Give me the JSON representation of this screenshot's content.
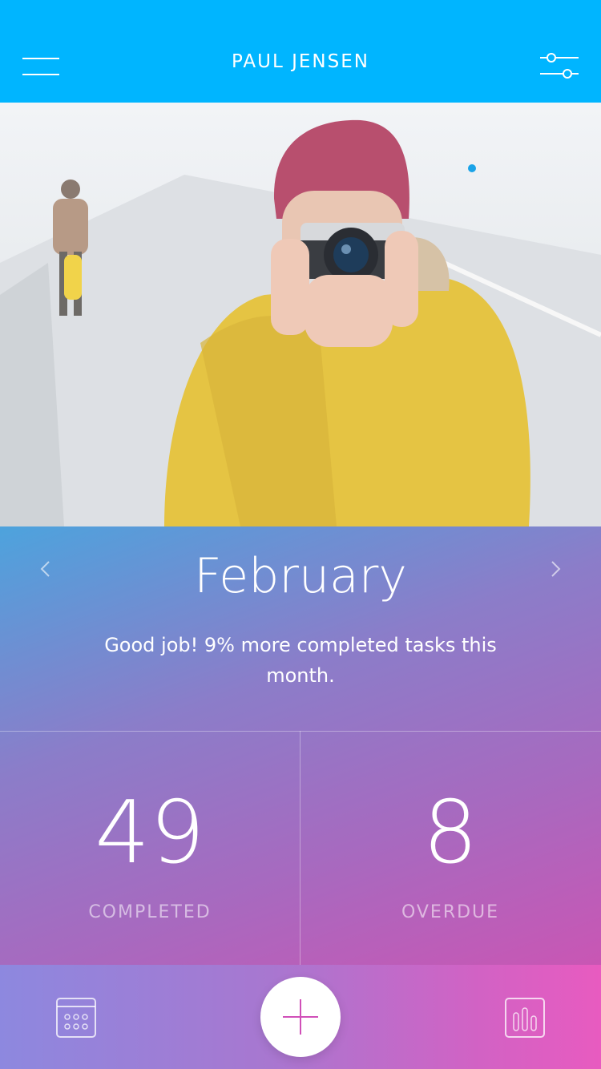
{
  "header": {
    "title": "PAUL JENSEN",
    "menu_icon": "hamburger-menu-icon",
    "filter_icon": "sliders-filter-icon"
  },
  "hero": {
    "icon": "photo-person-with-camera"
  },
  "summary": {
    "month": "February",
    "message": "Good job! 9% more completed tasks this month.",
    "prev_icon": "chevron-left-icon",
    "next_icon": "chevron-right-icon"
  },
  "stats": {
    "completed": {
      "value": "49",
      "label": "COMPLETED"
    },
    "overdue": {
      "value": "8",
      "label": "OVERDUE"
    }
  },
  "tabbar": {
    "calendar_icon": "calendar-icon",
    "add_icon": "plus-icon",
    "stats_icon": "bar-chart-icon"
  },
  "colors": {
    "header": "#00b5ff",
    "gradient_start": "#4da3dd",
    "gradient_end": "#c956b4",
    "accent_pink": "#e85bc0"
  }
}
